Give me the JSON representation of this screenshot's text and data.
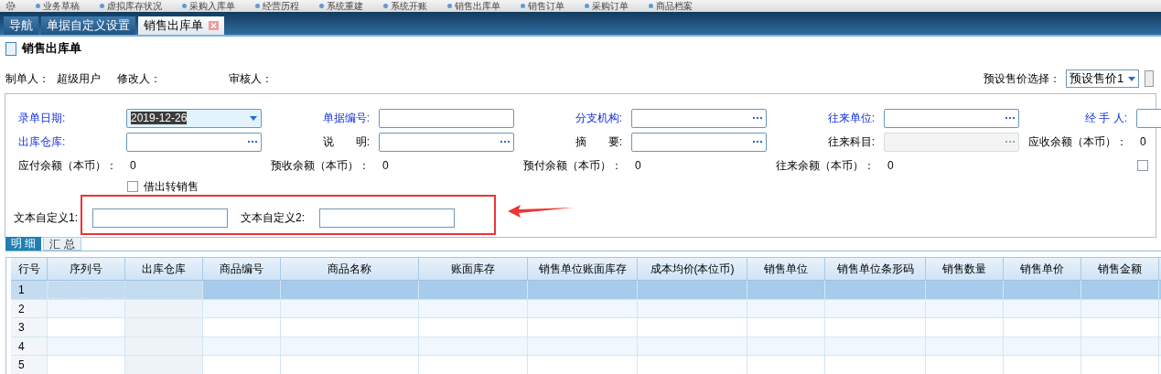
{
  "toolbar": {
    "items": [
      "业务草稿",
      "虚拟库存状况",
      "采购入库单",
      "经营历程",
      "系统重建",
      "系统开账",
      "销售出库单",
      "销售订单",
      "采购订单",
      "商品档案"
    ]
  },
  "tabs": [
    {
      "label": "导航",
      "selected": false,
      "closable": false
    },
    {
      "label": "单据自定义设置",
      "selected": false,
      "closable": false
    },
    {
      "label": "销售出库单",
      "selected": true,
      "closable": true
    }
  ],
  "page_title": "销售出库单",
  "meta": [
    {
      "label": "制单人：",
      "value": "超级用户"
    },
    {
      "label": "修改人："
    },
    {
      "label": "审核人："
    }
  ],
  "price_select": {
    "label": "预设售价选择：",
    "value": "预设售价1"
  },
  "form_rows": [
    [
      {
        "label": "录单日期:",
        "required": true,
        "kind": "date",
        "value": "2019-12-26"
      },
      {
        "label": "单据编号:",
        "required": true,
        "kind": "text"
      },
      {
        "label": "分支机构:",
        "required": true,
        "kind": "lookup"
      },
      {
        "label": "往来单位:",
        "required": true,
        "kind": "lookup"
      },
      {
        "label": "经 手 人:",
        "required": true,
        "kind": "text"
      }
    ],
    [
      {
        "label": "出库仓库:",
        "required": true,
        "kind": "lookup"
      },
      {
        "label": "说　　明:",
        "required": false,
        "kind": "lookup"
      },
      {
        "label": "摘　　要:",
        "required": false,
        "kind": "lookup"
      },
      {
        "label": "往来科目:",
        "required": false,
        "kind": "lookup",
        "disabled": true
      },
      {
        "label": "应收余额（本币）：",
        "required": false,
        "kind": "amount",
        "value": "0"
      }
    ],
    [
      {
        "label": "应付余额（本币）：",
        "required": false,
        "kind": "amount",
        "value": "0"
      },
      {
        "label": "预收余额（本币）：",
        "required": false,
        "kind": "amount",
        "value": "0"
      },
      {
        "label": "预付余额（本币）：",
        "required": false,
        "kind": "amount",
        "value": "0"
      },
      {
        "label": "往来余额（本币）：",
        "required": false,
        "kind": "amount",
        "value": "0"
      }
    ]
  ],
  "loan_checkbox": {
    "label": "借出转销售",
    "checked": false
  },
  "right_checkbox": {
    "checked": false
  },
  "custom_fields": [
    {
      "label": "文本自定义1:"
    },
    {
      "label": "文本自定义2:"
    }
  ],
  "detail_tabs": [
    {
      "label": "明 细",
      "selected": true
    },
    {
      "label": "汇 总",
      "selected": false
    }
  ],
  "table": {
    "columns": [
      "行号",
      "序列号",
      "出库仓库",
      "商品编号",
      "商品名称",
      "账面库存",
      "销售单位账面库存",
      "成本均价(本位币)",
      "销售单位",
      "销售单位条形码",
      "销售数量",
      "销售单价",
      "销售金额"
    ],
    "rows": [
      {
        "row_number": "1",
        "selected": true
      },
      {
        "row_number": "2",
        "selected": false
      },
      {
        "row_number": "3",
        "selected": false
      },
      {
        "row_number": "4",
        "selected": false
      },
      {
        "row_number": "5",
        "selected": false
      }
    ]
  }
}
